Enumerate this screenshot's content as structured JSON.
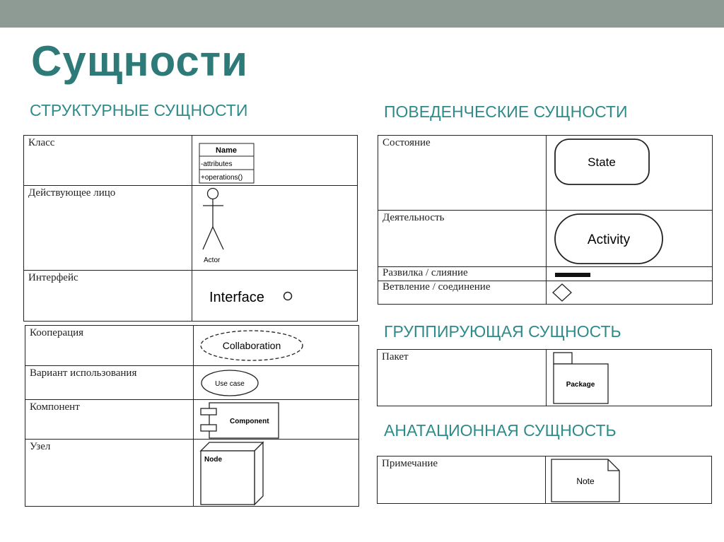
{
  "slide_title": "Сущности",
  "headings": {
    "structural": "СТРУКТУРНЫЕ СУЩНОСТИ",
    "behavioral": "ПОВЕДЕНЧЕСКИЕ СУЩНОСТИ",
    "grouping": "ГРУППИРУЮЩАЯ СУЩНОСТЬ",
    "annotation": "АНАТАЦИОННАЯ СУЩНОСТЬ"
  },
  "structural_table1": {
    "class_label": "Класс",
    "class_symbol": {
      "name": "Name",
      "attributes": "-attributes",
      "operations": "+operations()"
    },
    "actor_label": "Действующее лицо",
    "actor_symbol": "Actor",
    "interface_label": "Интерфейс",
    "interface_symbol": "Interface"
  },
  "structural_table2": {
    "cooperation_label": "Кооперация",
    "cooperation_symbol": "Collaboration",
    "usecase_label": "Вариант использования",
    "usecase_symbol": "Use case",
    "component_label": "Компонент",
    "component_symbol": "Component",
    "node_label": "Узел",
    "node_symbol": "Node"
  },
  "behavioral_table": {
    "state_label": "Состояние",
    "state_symbol": "State",
    "activity_label": "Деятельность",
    "activity_symbol": "Activity",
    "fork_label": "Развилка / слияние",
    "branch_label": "Ветвление / соединение"
  },
  "grouping_table": {
    "package_label": "Пакет",
    "package_symbol": "Package"
  },
  "annotation_table": {
    "note_label": "Примечание",
    "note_symbol": "Note"
  },
  "colors": {
    "topbar": "#8e9b94",
    "title": "#2e7a78",
    "heading": "#2e8b8a"
  }
}
